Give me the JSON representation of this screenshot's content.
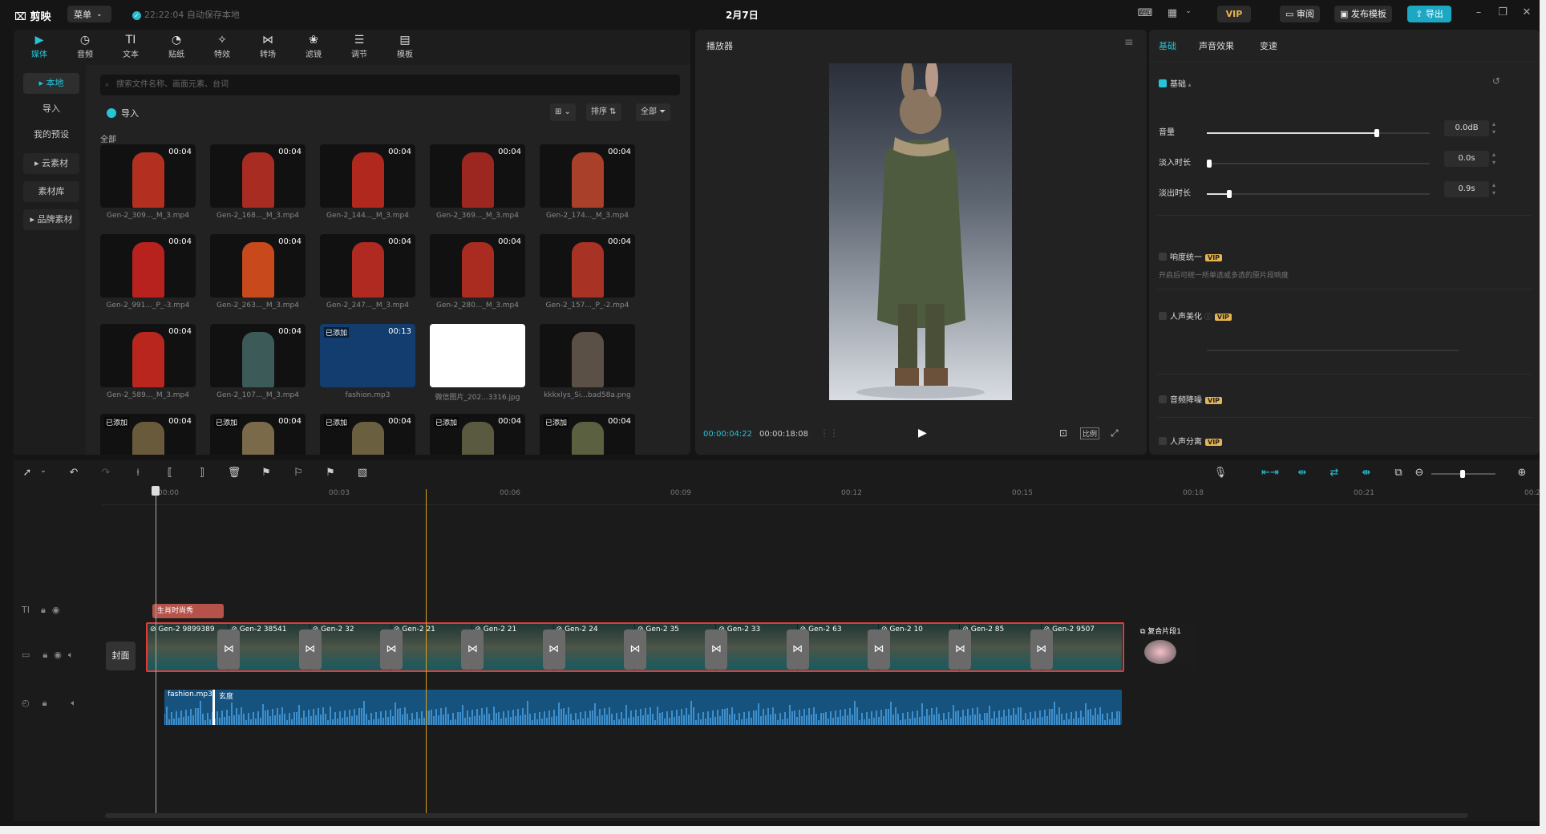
{
  "app": {
    "logo": "剪映",
    "menu_label": "菜单",
    "autosave": "22:22:04 自动保存本地",
    "date": "2月7日",
    "vip": "VIP",
    "review": "审阅",
    "publish_template": "发布模板",
    "export": "导出"
  },
  "media_tabs": [
    {
      "label": "媒体",
      "icon": "media-icon"
    },
    {
      "label": "音频",
      "icon": "audio-icon"
    },
    {
      "label": "文本",
      "icon": "text-icon"
    },
    {
      "label": "贴纸",
      "icon": "sticker-icon"
    },
    {
      "label": "特效",
      "icon": "effects-icon"
    },
    {
      "label": "转场",
      "icon": "transition-icon"
    },
    {
      "label": "滤镜",
      "icon": "filter-icon"
    },
    {
      "label": "调节",
      "icon": "adjust-icon"
    },
    {
      "label": "模板",
      "icon": "template-icon"
    }
  ],
  "sidebar": [
    "本地",
    "导入",
    "我的预设",
    "云素材",
    "素材库",
    "品牌素材"
  ],
  "search_placeholder": "搜索文件名称、画面元素、台词",
  "import_label": "导入",
  "sort_label": "排序",
  "all_filter_label": "全部",
  "all_section_label": "全部",
  "added_label": "已添加",
  "media_items": [
    {
      "name": "Gen-2_309..._M_3.mp4",
      "duration": "00:04",
      "color": "#b33020"
    },
    {
      "name": "Gen-2_168..._M_3.mp4",
      "duration": "00:04",
      "color": "#a82c22"
    },
    {
      "name": "Gen-2_144..._M_3.mp4",
      "duration": "00:04",
      "color": "#b0281e"
    },
    {
      "name": "Gen-2_369..._M_3.mp4",
      "duration": "00:04",
      "color": "#9c2620"
    },
    {
      "name": "Gen-2_174..._M_3.mp4",
      "duration": "00:04",
      "color": "#a8402a"
    },
    {
      "name": "Gen-2_991..._P_-3.mp4",
      "duration": "00:04",
      "color": "#b8221e"
    },
    {
      "name": "Gen-2_263..._M_3.mp4",
      "duration": "00:04",
      "color": "#c84a1c"
    },
    {
      "name": "Gen-2_247..._M_3.mp4",
      "duration": "00:04",
      "color": "#b02a22"
    },
    {
      "name": "Gen-2_280..._M_3.mp4",
      "duration": "00:04",
      "color": "#aa2c20"
    },
    {
      "name": "Gen-2_157..._P_-2.mp4",
      "duration": "00:04",
      "color": "#a83224"
    },
    {
      "name": "Gen-2_589..._M_3.mp4",
      "duration": "00:04",
      "color": "#b8261e"
    },
    {
      "name": "Gen-2_107..._M_3.mp4",
      "duration": "00:04",
      "color": "#3c5a58"
    },
    {
      "name": "fashion.mp3",
      "duration": "00:13",
      "color": "#123d6e",
      "added": true
    },
    {
      "name": "微信图片_202...3316.jpg",
      "duration": "",
      "color": "#ffffff"
    },
    {
      "name": "kkkxlys_Si...bad58a.png",
      "duration": "",
      "color": "#5a5046"
    },
    {
      "name": "",
      "duration": "00:04",
      "color": "#6a5a3c",
      "added": true
    },
    {
      "name": "",
      "duration": "00:04",
      "color": "#7a6a4a",
      "added": true
    },
    {
      "name": "",
      "duration": "00:04",
      "color": "#6a6040",
      "added": true
    },
    {
      "name": "",
      "duration": "00:04",
      "color": "#5a5a40",
      "added": true
    },
    {
      "name": "",
      "duration": "00:04",
      "color": "#5a6040",
      "added": true
    }
  ],
  "player": {
    "title": "播放器",
    "current_time": "00:00:04:22",
    "total_time": "00:00:18:08",
    "ratio_label": "比例"
  },
  "props": {
    "tabs": [
      "基础",
      "声音效果",
      "变速"
    ],
    "basic_label": "基础",
    "volume": {
      "label": "音量",
      "value": "0.0dB",
      "level": 0.75
    },
    "fade_in": {
      "label": "淡入时长",
      "value": "0.0s",
      "level": 0.0
    },
    "fade_out": {
      "label": "淡出时长",
      "value": "0.9s",
      "level": 0.09
    },
    "loudness": {
      "label": "响度统一",
      "desc": "开启后可统一所单选或多选的原片段响度"
    },
    "voice_beautify": "人声美化",
    "noise_reduce": "音频降噪",
    "voice_separate": "人声分离",
    "vip_badge": "VIP"
  },
  "timeline": {
    "ticks": [
      "00:00",
      "00:03",
      "00:06",
      "00:09",
      "00:12",
      "00:15",
      "00:18",
      "00:21",
      "00:2"
    ],
    "cover_label": "封面",
    "text_clip": "生肖时尚秀",
    "video_clips": [
      "Gen-2 9899389",
      "Gen-2 38541",
      "Gen-2 32",
      "Gen-2 21",
      "Gen-2 21",
      "Gen-2 24",
      "Gen-2 35",
      "Gen-2 33",
      "Gen-2 63",
      "Gen-2 10",
      "Gen-2 85",
      "Gen-2 9507"
    ],
    "compound_clip": "复合片段1",
    "audio_clip_1": "fashion.mp3",
    "audio_clip_2": "玄度"
  },
  "colors": {
    "accent": "#27c3d8",
    "selection": "#e03c3c",
    "playhead": "#d9a21c"
  }
}
